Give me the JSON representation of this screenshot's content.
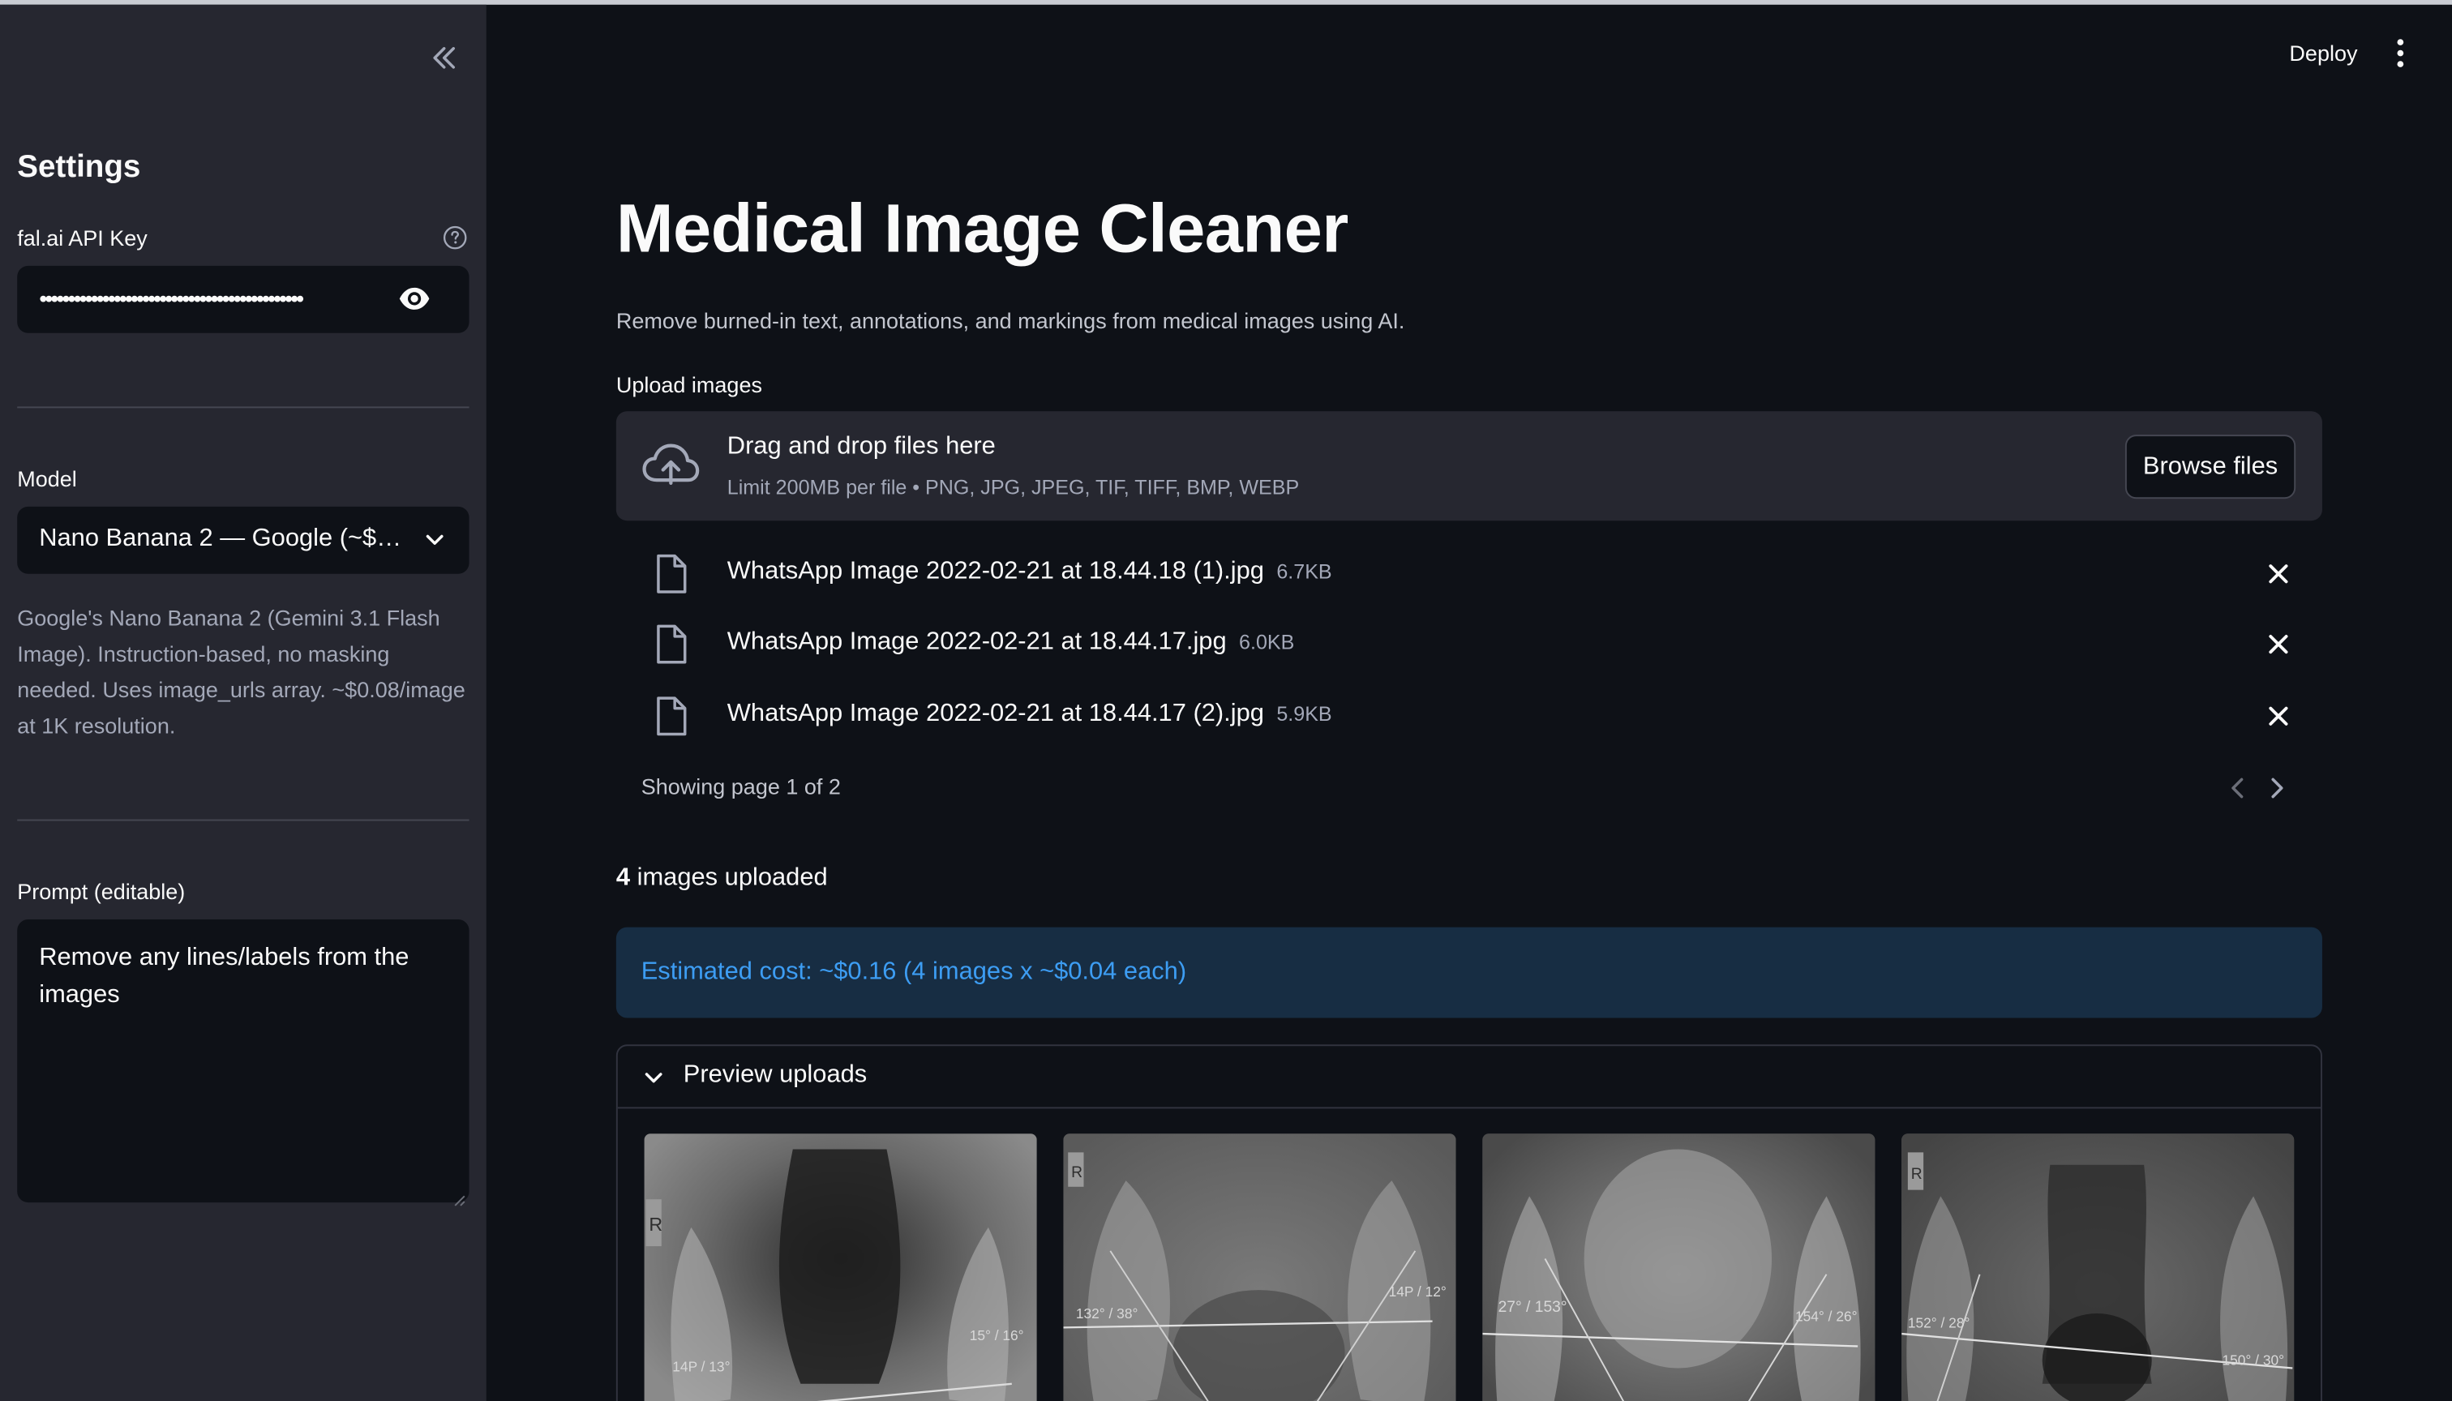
{
  "sidebar": {
    "title": "Settings",
    "api_key": {
      "label": "fal.ai API Key",
      "value": "••••••••••••••••••••••••••••••••••••••••••••••"
    },
    "model": {
      "label": "Model",
      "selected": "Nano Banana 2 — Google (~$…",
      "description": "Google's Nano Banana 2 (Gemini 3.1 Flash Image). Instruction-based, no masking needed. Uses image_urls array. ~$0.08/image at 1K resolution."
    },
    "prompt": {
      "label": "Prompt (editable)",
      "value": "Remove any lines/labels from the images"
    }
  },
  "header": {
    "deploy_label": "Deploy"
  },
  "main": {
    "title": "Medical Image Cleaner",
    "subtitle": "Remove burned-in text, annotations, and markings from medical images using AI.",
    "uploader": {
      "label": "Upload images",
      "dropzone_title": "Drag and drop files here",
      "dropzone_limit": "Limit 200MB per file • PNG, JPG, JPEG, TIF, TIFF, BMP, WEBP",
      "browse_label": "Browse files",
      "files": [
        {
          "name": "WhatsApp Image 2022-02-21 at 18.44.18 (1).jpg",
          "size": "6.7KB"
        },
        {
          "name": "WhatsApp Image 2022-02-21 at 18.44.17.jpg",
          "size": "6.0KB"
        },
        {
          "name": "WhatsApp Image 2022-02-21 at 18.44.17 (2).jpg",
          "size": "5.9KB"
        }
      ],
      "pagination": "Showing page 1 of 2"
    },
    "upload_count": {
      "number": "4",
      "text": " images uploaded"
    },
    "cost_info": "Estimated cost: ~$0.16 (4 images x ~$0.04 each)",
    "preview": {
      "label": "Preview uploads",
      "images": [
        {
          "marker": "R",
          "angle_left": "14P / 13°",
          "angle_right": "15° / 16°"
        },
        {
          "marker": "R",
          "angle_left": "132° / 38°",
          "angle_right": "14P / 12°"
        },
        {
          "marker": "",
          "angle_left": "27° / 153°",
          "angle_right": "154° / 26°"
        },
        {
          "marker": "R",
          "angle_left": "152° / 28°",
          "angle_right": "150° / 30°"
        }
      ]
    }
  },
  "colors": {
    "background": "#0e1117",
    "sidebar": "#262730",
    "info_bg": "#172d43",
    "info_text": "#3d9df3"
  },
  "icons": [
    "collapse-sidebar-icon",
    "help-icon",
    "eye-icon",
    "chevron-down-icon",
    "cloud-upload-icon",
    "file-icon",
    "close-icon",
    "chevron-left-icon",
    "chevron-right-icon",
    "more-vertical-icon"
  ]
}
